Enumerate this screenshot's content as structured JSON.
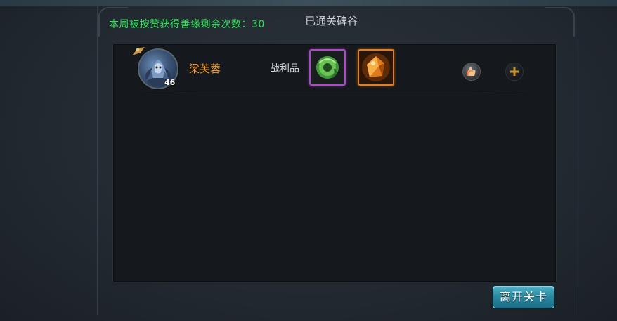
{
  "header": {
    "weekly_text": "本周被按赞获得善缘剩余次数：30",
    "title": "已通关碑谷"
  },
  "player": {
    "name": "梁芙蓉",
    "level": "46"
  },
  "loot": {
    "label": "战利品",
    "items": [
      {
        "icon": "green-jade-ring-icon",
        "rarity_color": "#a94bc7"
      },
      {
        "icon": "amber-gem-icon",
        "rarity_color": "#e2801f"
      }
    ]
  },
  "actions": {
    "like_icon": "thumbs-up-icon",
    "add_icon": "plus-icon",
    "leave_label": "离开关卡"
  },
  "colors": {
    "weekly_text": "#32e35a",
    "player_name": "#f29a2a",
    "leave_button": "#2a8aa2"
  }
}
